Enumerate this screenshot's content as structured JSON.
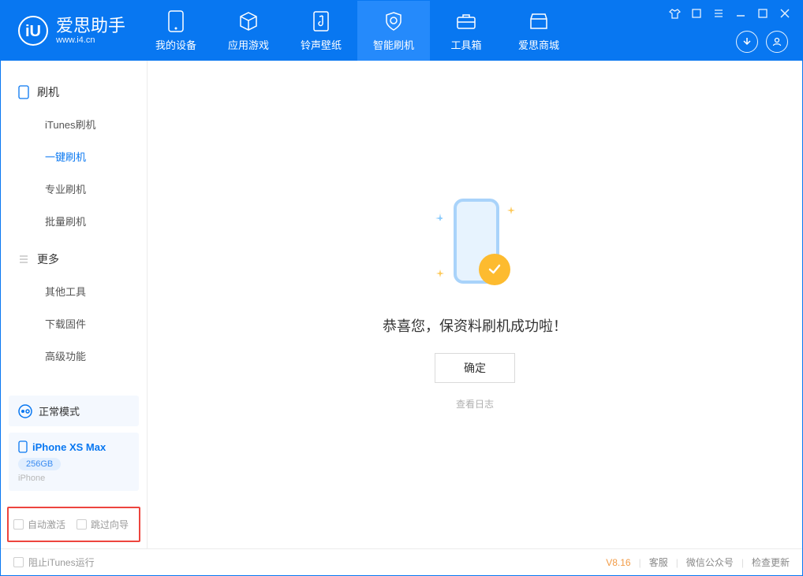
{
  "brand": {
    "name": "爱思助手",
    "url": "www.i4.cn"
  },
  "nav": {
    "0": "我的设备",
    "1": "应用游戏",
    "2": "铃声壁纸",
    "3": "智能刷机",
    "4": "工具箱",
    "5": "爱思商城"
  },
  "sidebar": {
    "group_flash": "刷机",
    "items_flash": {
      "0": "iTunes刷机",
      "1": "一键刷机",
      "2": "专业刷机",
      "3": "批量刷机"
    },
    "group_more": "更多",
    "items_more": {
      "0": "其他工具",
      "1": "下载固件",
      "2": "高级功能"
    },
    "mode": "正常模式",
    "device": {
      "name": "iPhone XS Max",
      "capacity": "256GB",
      "type": "iPhone"
    },
    "opt_auto": "自动激活",
    "opt_skip": "跳过向导"
  },
  "main": {
    "message": "恭喜您，保资料刷机成功啦！",
    "ok": "确定",
    "viewlog": "查看日志"
  },
  "footer": {
    "block_itunes": "阻止iTunes运行",
    "version": "V8.16",
    "l1": "客服",
    "l2": "微信公众号",
    "l3": "检查更新"
  }
}
